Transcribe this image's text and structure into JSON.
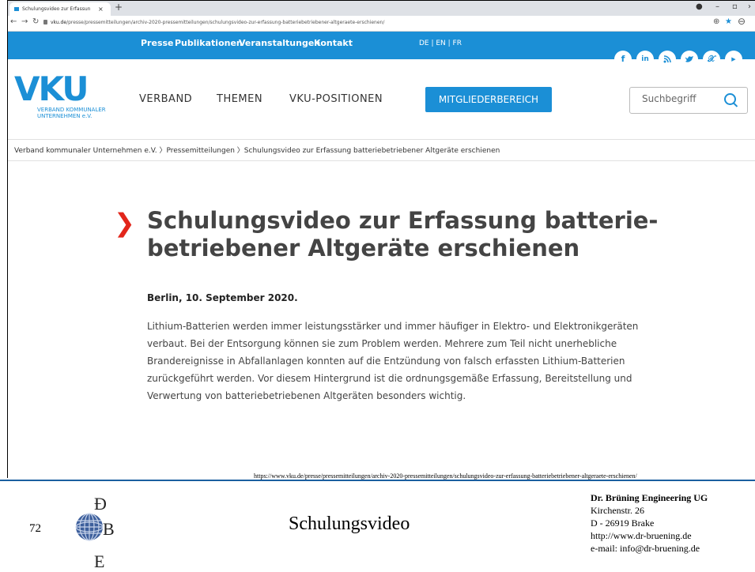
{
  "browser": {
    "tab_title": "Schulungsvideo zur Erfassung bat",
    "tab_close": "×",
    "new_tab": "+",
    "url_domain": "vku.de",
    "url_path": "/presse/pressemitteilungen/archiv-2020-pressemitteilungen/schulungsvideo-zur-erfassung-batteriebetriebener-altgeraete-erschienen/"
  },
  "site": {
    "topnav": [
      "Presse",
      "Publikationen",
      "Veranstaltungen",
      "Kontakt"
    ],
    "languages": "DE | EN | FR",
    "social": [
      "f",
      "in",
      "rss",
      "t",
      "x",
      "yt"
    ],
    "logo_text": "VKU",
    "logo_sub": "VERBAND KOMMUNALER UNTERNEHMEN e.V.",
    "menu": [
      "VERBAND",
      "THEMEN",
      "VKU-POSITIONEN"
    ],
    "member_button": "MITGLIEDERBEREICH",
    "search_placeholder": "Suchbegriff",
    "breadcrumb": "Verband kommunaler Unternehmen e.V.  〉Pressemitteilungen  〉Schulungsvideo zur Erfassung batteriebetriebener Altgeräte erschienen",
    "headline": "Schulungsvideo zur Erfassung batterie-betriebener Altgeräte erschienen",
    "dateline": "Berlin, 10. September 2020.",
    "body": "Lithium-Batterien werden immer leistungsstärker und immer häufiger in Elektro- und Elektronikgeräten verbaut. Bei der Entsorgung können sie zum Problem werden. Mehrere zum Teil nicht unerhebliche Brandereignisse in Abfallanlagen konnten auf die Entzündung von falsch erfassten Lithium-Batterien zurückgeführt werden. Vor diesem Hintergrund ist die ordnungsgemäße Erfassung, Bereitstellung und Verwertung von batteriebetriebenen Altgeräten besonders wichtig."
  },
  "slide": {
    "source_url": "https://www.vku.de/presse/pressemitteilungen/archiv-2020-pressemitteilungen/schulungsvideo-zur-erfassung-batteriebetriebener-altgeraete-erschienen/",
    "page_number": "72",
    "title": "Schulungsvideo",
    "company_name": "Dr. Brüning Engineering UG",
    "street": "Kirchenstr. 26",
    "city": "D - 26919 Brake",
    "website": "http://www.dr-bruening.de",
    "email": "e-mail: info@dr-bruening.de"
  },
  "colors": {
    "brand_blue": "#1b8fd6",
    "accent_red": "#e2261b"
  }
}
